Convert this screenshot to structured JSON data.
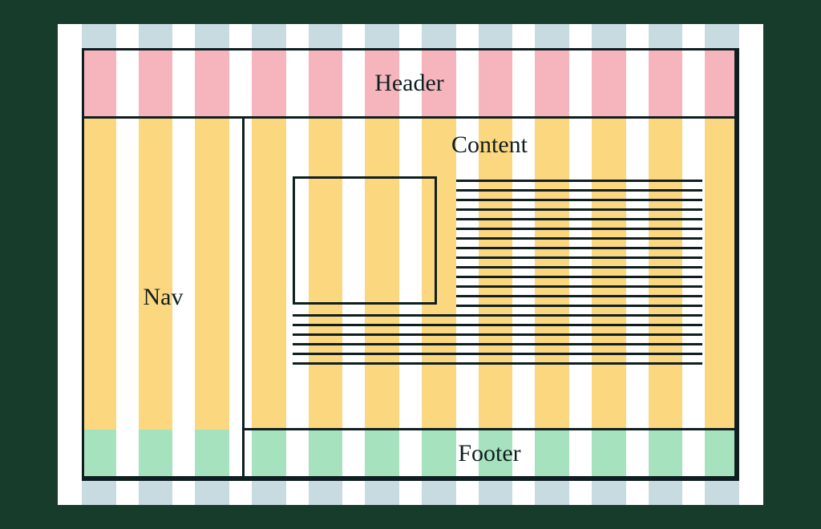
{
  "regions": {
    "header": "Header",
    "nav": "Nav",
    "content": "Content",
    "footer": "Footer"
  },
  "grid": {
    "columns": 12
  },
  "colors": {
    "header_stripe": "#f6b5bc",
    "mid_stripe": "#fbd77f",
    "footer_stripe": "#a7e2bf",
    "edge_stripe": "#c7dbe1",
    "outline": "#0f1f21"
  }
}
